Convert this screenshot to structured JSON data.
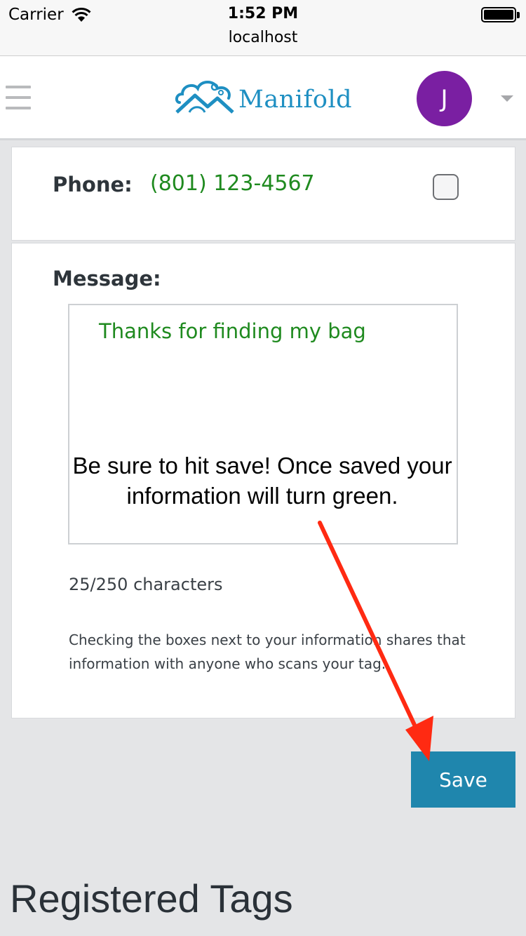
{
  "status_bar": {
    "carrier": "Carrier",
    "time": "1:52 PM",
    "url": "localhost"
  },
  "header": {
    "menu_icon": "hamburger-menu-icon",
    "logo_text": "Manifold",
    "avatar_initial": "J",
    "avatar_color": "#7a1fa2",
    "dropdown_icon": "caret-down-icon"
  },
  "form": {
    "phone_label": "Phone:",
    "phone_value": "(801) 123-4567",
    "phone_shared_checked": false,
    "message_label": "Message:",
    "message_value": "Thanks for finding my bag",
    "char_count": "25/250 characters",
    "help_text": "Checking the boxes next to your information shares that information with anyone who scans your tag.",
    "save_label": "Save"
  },
  "annotation": {
    "text": "Be sure to hit save! Once saved your information will turn green.",
    "arrow_color": "#ff2a12"
  },
  "section": {
    "title": "Registered Tags"
  },
  "colors": {
    "accent": "#1f86ad",
    "saved_text": "#1f8a1f",
    "page_bg": "#e4e5e7"
  }
}
